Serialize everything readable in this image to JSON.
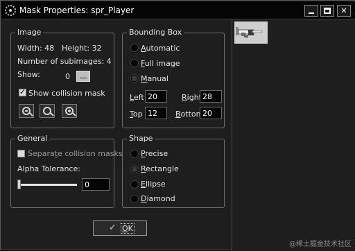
{
  "window": {
    "title": "Mask Properties: spr_Player",
    "icon": "gear-icon",
    "controls": [
      "minimize-icon",
      "maximize-icon",
      "close-icon"
    ],
    "close_glyph": "✕"
  },
  "image": {
    "title": "Image",
    "width_label": "Width: 48",
    "height_label": "Height: 32",
    "subimages_label": "Number of subimages: 4",
    "show_label": "Show:",
    "show_value": "0",
    "show_collision_label": "Show collision mask",
    "show_collision_checked": true,
    "zoom_buttons": [
      "zoom-out-icon",
      "zoom-reset-icon",
      "zoom-in-icon"
    ]
  },
  "bounding": {
    "title": "Bounding Box",
    "options": [
      {
        "pre": "",
        "ul": "A",
        "post": "utomatic"
      },
      {
        "pre": "",
        "ul": "F",
        "post": "ull image"
      },
      {
        "pre": "",
        "ul": "M",
        "post": "anual"
      }
    ],
    "selected": "Manual",
    "left": {
      "pre": "",
      "ul": "L",
      "post": "eft",
      "value": "20"
    },
    "right": {
      "pre": "",
      "ul": "R",
      "post": "ight",
      "value": "28"
    },
    "top": {
      "pre": "",
      "ul": "T",
      "post": "op",
      "value": "12"
    },
    "bottom": {
      "pre": "",
      "ul": "B",
      "post": "ottom",
      "value": "20"
    }
  },
  "general": {
    "title": "General",
    "separate_pre": "Separa",
    "separate_ul": "t",
    "separate_post": "e collision masks",
    "separate_checked": false,
    "alpha_label": "Alpha Tolerance:",
    "alpha_value": "0",
    "alpha_fraction": 0
  },
  "shape": {
    "title": "Shape",
    "options": [
      {
        "pre": "",
        "ul": "P",
        "post": "recise"
      },
      {
        "pre": "",
        "ul": "R",
        "post": "ectangle"
      },
      {
        "pre": "",
        "ul": "E",
        "post": "llipse"
      },
      {
        "pre": "",
        "ul": "D",
        "post": "iamond"
      }
    ],
    "selected": "Rectangle"
  },
  "ok": {
    "pre": "",
    "ul": "O",
    "post": "K",
    "check_glyph": "✓"
  },
  "watermark": "@稀土掘金技术社区",
  "colors": {
    "background": "#1e1e1e",
    "field": "#050505",
    "text": "#e6e6e6"
  }
}
